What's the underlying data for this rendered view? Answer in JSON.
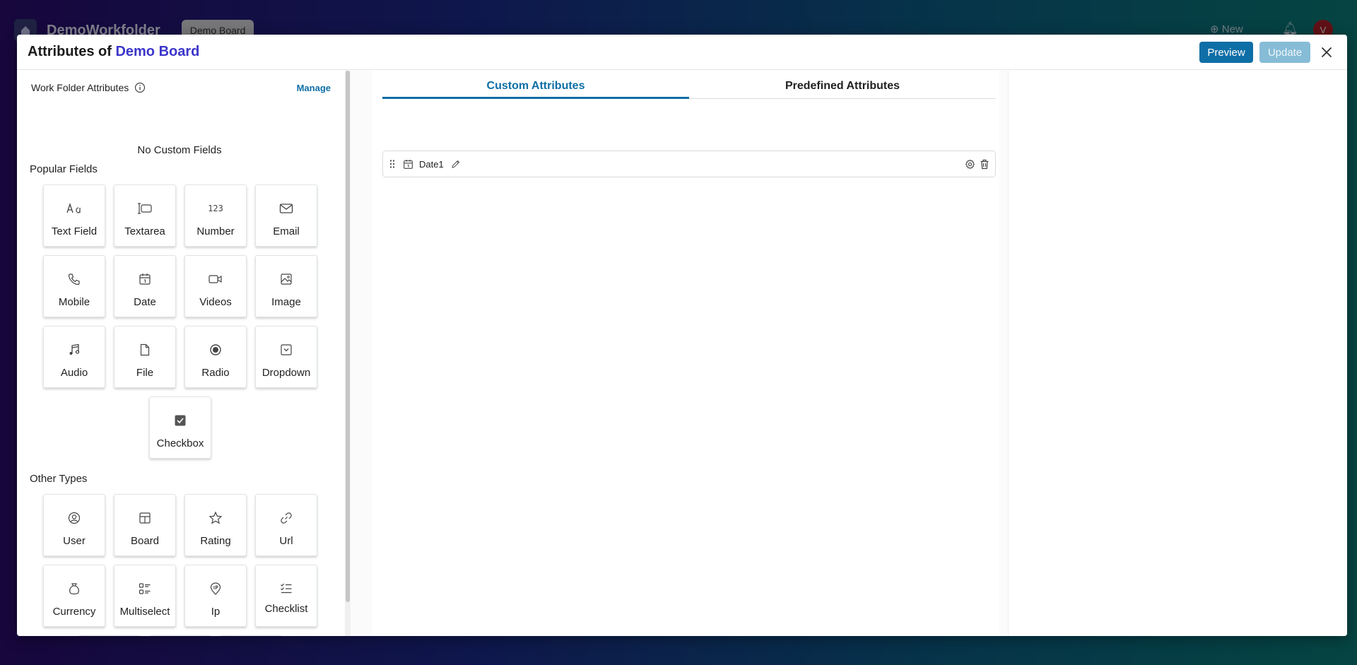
{
  "background": {
    "workspace_title": "DemoWorkfolder",
    "board_tab": "Demo Board",
    "new_label": "New",
    "avatar_initial": "V"
  },
  "modal": {
    "title_prefix": "Attributes of",
    "title_board": "Demo Board",
    "preview_label": "Preview",
    "update_label": "Update"
  },
  "left": {
    "work_folder_label": "Work Folder Attributes",
    "manage_label": "Manage",
    "no_custom_text": "No Custom Fields",
    "popular_title": "Popular Fields",
    "other_title": "Other Types",
    "popular_fields": [
      {
        "label": "Text Field",
        "icon": "text-field-icon"
      },
      {
        "label": "Textarea",
        "icon": "textarea-icon"
      },
      {
        "label": "Number",
        "icon": "number-icon"
      },
      {
        "label": "Email",
        "icon": "email-icon"
      },
      {
        "label": "Mobile",
        "icon": "phone-icon"
      },
      {
        "label": "Date",
        "icon": "calendar-icon"
      },
      {
        "label": "Videos",
        "icon": "video-icon"
      },
      {
        "label": "Image",
        "icon": "image-icon"
      },
      {
        "label": "Audio",
        "icon": "music-icon"
      },
      {
        "label": "File",
        "icon": "file-icon"
      },
      {
        "label": "Radio",
        "icon": "radio-icon"
      },
      {
        "label": "Dropdown",
        "icon": "dropdown-icon"
      },
      {
        "label": "Checkbox",
        "icon": "checkbox-icon"
      }
    ],
    "other_types": [
      {
        "label": "User",
        "icon": "user-icon"
      },
      {
        "label": "Board",
        "icon": "board-icon"
      },
      {
        "label": "Rating",
        "icon": "star-icon"
      },
      {
        "label": "Url",
        "icon": "link-icon"
      },
      {
        "label": "Currency",
        "icon": "money-bag-icon"
      },
      {
        "label": "Multiselect",
        "icon": "multiselect-icon"
      },
      {
        "label": "Ip",
        "icon": "ip-icon"
      },
      {
        "label": "Checklist",
        "icon": "checklist-icon"
      },
      {
        "label": "",
        "icon": "hand-pointer-icon"
      },
      {
        "label": "",
        "icon": "flag-icon"
      },
      {
        "label": "",
        "icon": "location-pin-icon"
      }
    ]
  },
  "center": {
    "tab_custom": "Custom Attributes",
    "tab_predefined": "Predefined Attributes",
    "attributes": [
      {
        "name": "Date1",
        "icon": "calendar-icon"
      }
    ]
  },
  "colors": {
    "primary": "#0e6ea6",
    "board_link": "#3b35c9",
    "update_disabled": "#86bcd6"
  }
}
